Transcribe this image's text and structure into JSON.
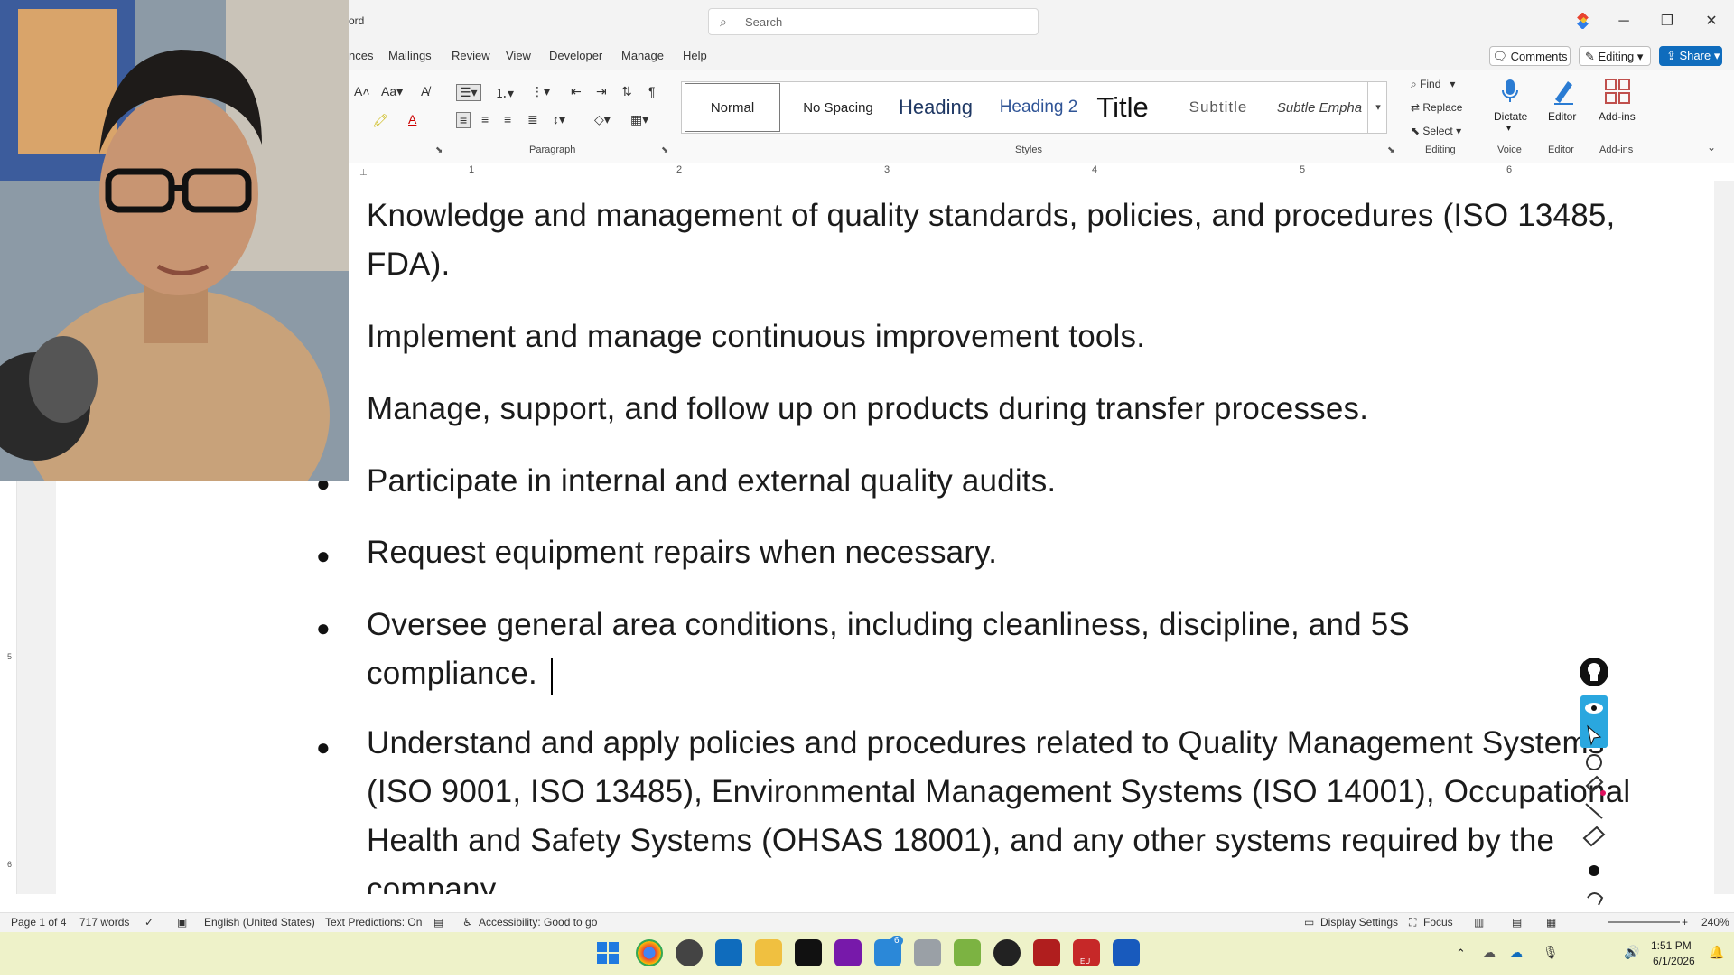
{
  "window": {
    "app_name_fragment": "ord",
    "search_placeholder": "Search",
    "minimize": "─",
    "restore": "❐",
    "close": "✕"
  },
  "menu": [
    "nces",
    "Mailings",
    "Review",
    "View",
    "Developer",
    "Manage",
    "Help"
  ],
  "actions": {
    "comments": "Comments",
    "editing": "Editing",
    "share": "Share"
  },
  "ribbon": {
    "paragraph_label": "Paragraph",
    "styles_label": "Styles",
    "editing_label": "Editing",
    "voice_label": "Voice",
    "editor_label": "Editor",
    "addins_label": "Add-ins",
    "styles": [
      "Normal",
      "No Spacing",
      "Heading",
      "Heading 2",
      "Title",
      "Subtitle",
      "Subtle Empha"
    ],
    "find": "Find",
    "replace": "Replace",
    "select": "Select",
    "dictate": "Dictate",
    "editor": "Editor",
    "addins": "Add-ins"
  },
  "ruler_numbers": [
    "1",
    "2",
    "3",
    "4",
    "5",
    "6"
  ],
  "vruler_numbers": [
    "5",
    "6"
  ],
  "document": {
    "paragraphs": [
      "Knowledge and management of quality standards, policies, and procedures (ISO 13485, FDA).",
      "Implement and manage continuous improvement tools.",
      "Manage, support, and follow up on products during transfer processes.",
      "Participate in internal and external quality audits.",
      "Request equipment repairs when necessary.",
      "Oversee general area conditions, including cleanliness, discipline, and 5S compliance.",
      "Understand and apply policies and procedures related to Quality Management Systems (ISO 9001, ISO 13485), Environmental Management Systems (ISO 14001), Occupational Health and Safety Systems (OHSAS 18001), and any other systems required by the company."
    ]
  },
  "statusbar": {
    "page": "Page 1 of 4",
    "words": "717 words",
    "language": "English (United States)",
    "text_predictions": "Text Predictions: On",
    "accessibility": "Accessibility: Good to go",
    "display_settings": "Display Settings",
    "focus": "Focus",
    "zoom": "240%"
  },
  "taskbar": {
    "time": "1:51 PM",
    "date": "6/1/2026",
    "badge_count": "6",
    "eu_label": "EU"
  },
  "colors": {
    "accent": "#0f6cbd",
    "taskbar": "#eef2c9",
    "pen_toolbar": "#2aa7df"
  }
}
